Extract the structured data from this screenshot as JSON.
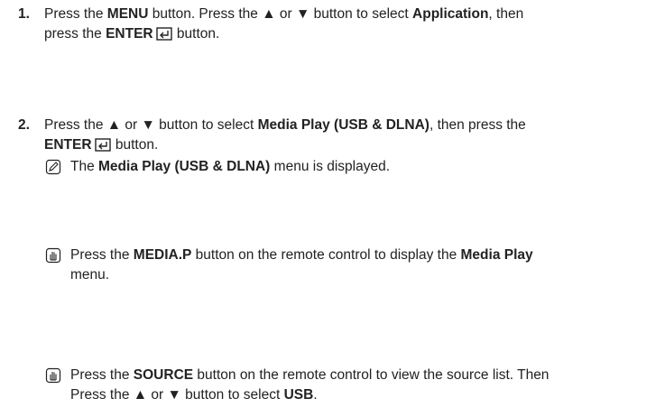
{
  "step1": {
    "number": "1.",
    "line1_pre": "Press the ",
    "menu": "MENU",
    "line1_mid": " button. Press the ▲ or ▼ button to select ",
    "application": "Application",
    "line1_post": ", then",
    "line2_pre": "press the ",
    "enter": "ENTER",
    "line2_post": " button."
  },
  "step2": {
    "number": "2.",
    "line1_pre": "Press the ▲ or ▼ button to select ",
    "media_play_usb": "Media Play (USB & DLNA)",
    "line1_post": ", then press the",
    "enter": "ENTER",
    "line2_post": " button."
  },
  "note1": {
    "pre": "The ",
    "bold": "Media Play (USB & DLNA)",
    "post": " menu is displayed."
  },
  "note2": {
    "pre": "Press the ",
    "bold1": "MEDIA.P",
    "mid": " button on the remote control to display the ",
    "bold2": "Media Play",
    "line2": "menu."
  },
  "note3": {
    "pre": "Press the ",
    "bold1": "SOURCE",
    "mid": " button on the remote control to view the source list. Then",
    "line2_pre": "Press the ▲ or ▼ button to select ",
    "bold2": "USB",
    "line2_post": "."
  }
}
